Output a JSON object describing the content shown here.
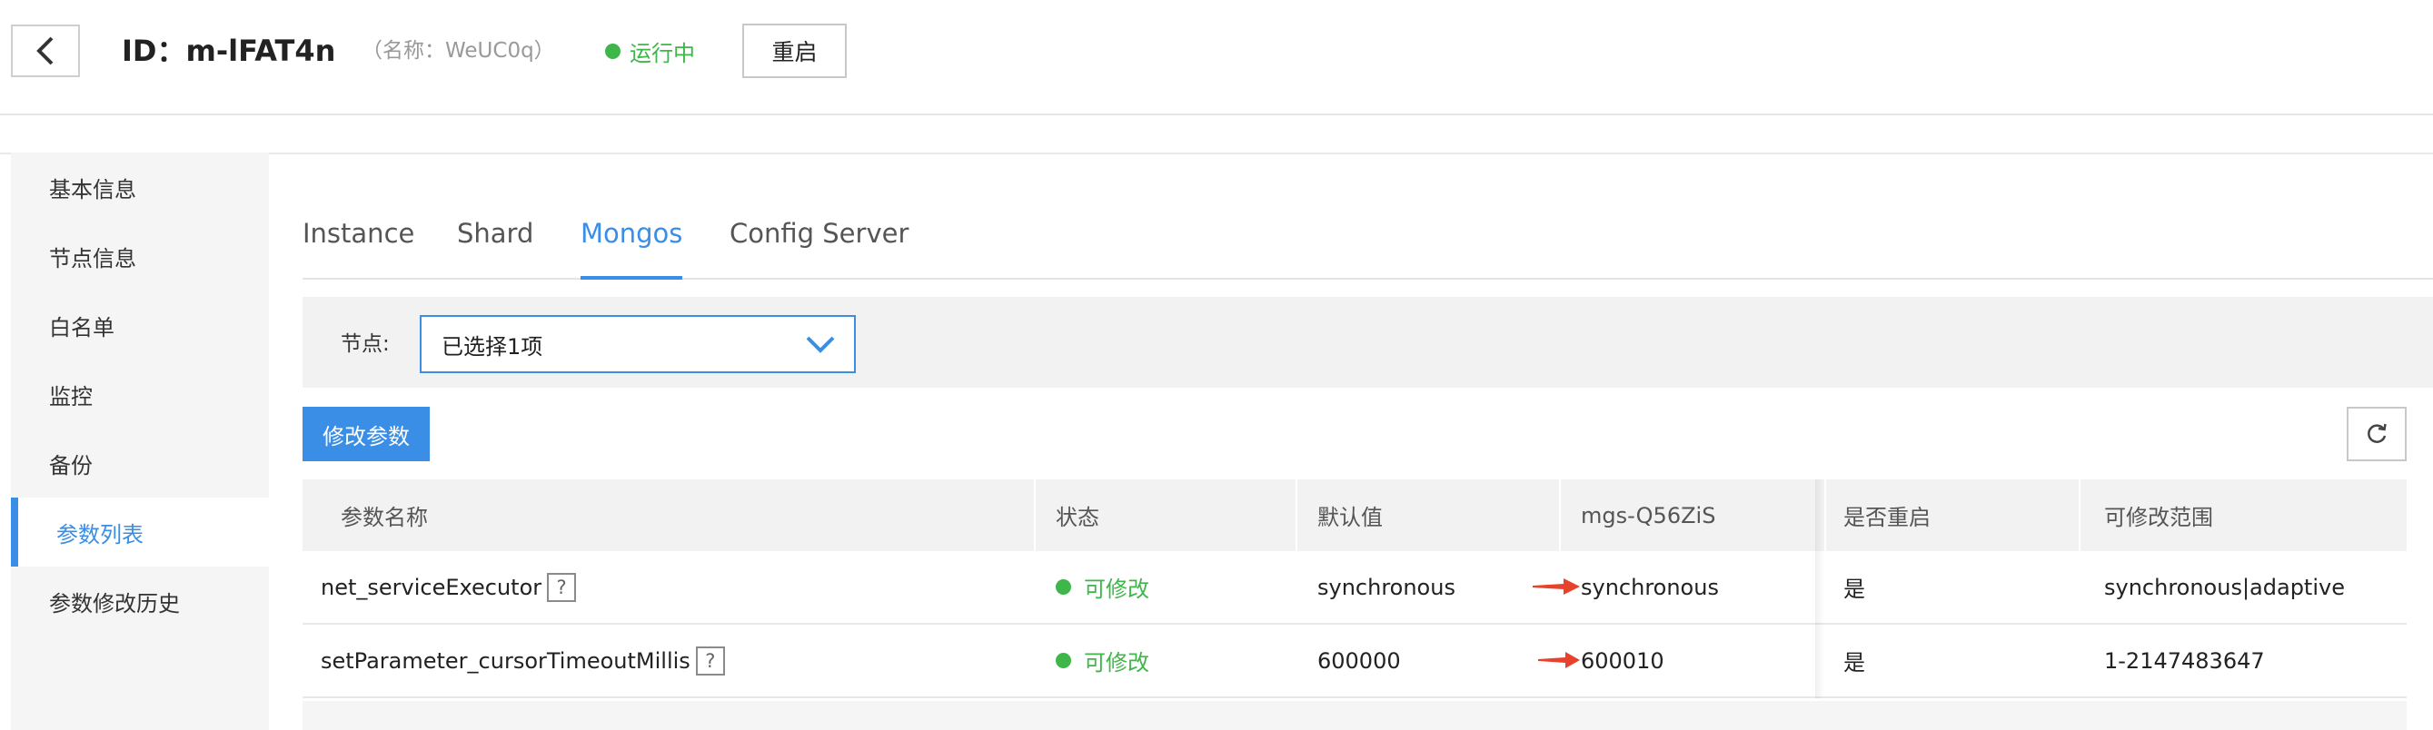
{
  "header": {
    "title": "ID：m-lFAT4n",
    "subtitle": "（名称：WeUC0q）",
    "status": "运行中",
    "restart_label": "重启"
  },
  "sidebar": {
    "items": [
      {
        "label": "基本信息"
      },
      {
        "label": "节点信息"
      },
      {
        "label": "白名单"
      },
      {
        "label": "监控"
      },
      {
        "label": "备份"
      },
      {
        "label": "参数列表"
      },
      {
        "label": "参数修改历史"
      }
    ],
    "active": "参数列表"
  },
  "tabs": {
    "items": [
      {
        "label": "Instance"
      },
      {
        "label": "Shard"
      },
      {
        "label": "Mongos"
      },
      {
        "label": "Config Server"
      }
    ],
    "active": "Mongos"
  },
  "filter": {
    "label": "节点:",
    "selected": "已选择1项"
  },
  "toolbar": {
    "edit_label": "修改参数"
  },
  "table": {
    "columns": [
      "参数名称",
      "状态",
      "默认值",
      "mgs-Q56ZiS",
      "是否重启",
      "可修改范围"
    ],
    "rows": [
      {
        "name": "net_serviceExecutor",
        "help": "?",
        "status": "可修改",
        "default": "synchronous",
        "value": "synchronous",
        "restart": "是",
        "range": "synchronous|adaptive"
      },
      {
        "name": "setParameter_cursorTimeoutMillis",
        "help": "?",
        "status": "可修改",
        "default": "600000",
        "value": "600010",
        "restart": "是",
        "range": "1-2147483647"
      }
    ]
  },
  "colors": {
    "accent": "#3a8ee6",
    "status_green": "#3eb64a",
    "annotation_arrow": "#e8412c"
  },
  "icons": [
    "chevron-left-icon",
    "chevron-down-icon",
    "refresh-icon",
    "help-icon",
    "red-arrow-icon"
  ]
}
